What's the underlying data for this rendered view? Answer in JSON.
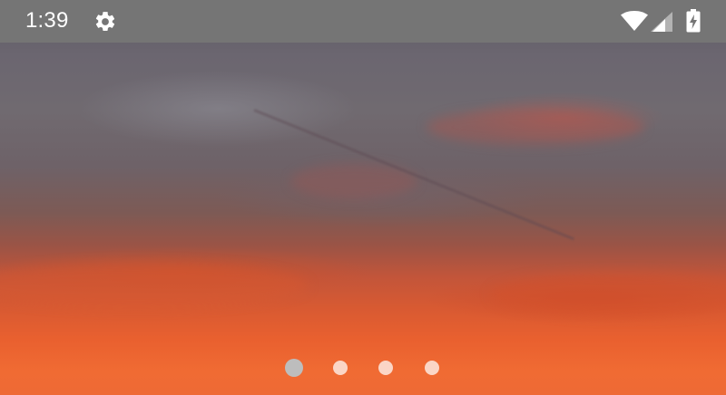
{
  "status_bar": {
    "time": "1:39",
    "settings_icon": "gear-icon",
    "wifi_icon": "wifi-icon",
    "signal_icon": "cell-signal-icon",
    "battery_icon": "battery-charging-icon",
    "background_color": "#757575"
  },
  "wallpaper": {
    "description_icon": "sunset-wallpaper"
  },
  "pager": {
    "page_count": 4,
    "active_index": 0,
    "active_color": "#bdbdbd",
    "inactive_color": "#ffffff"
  }
}
